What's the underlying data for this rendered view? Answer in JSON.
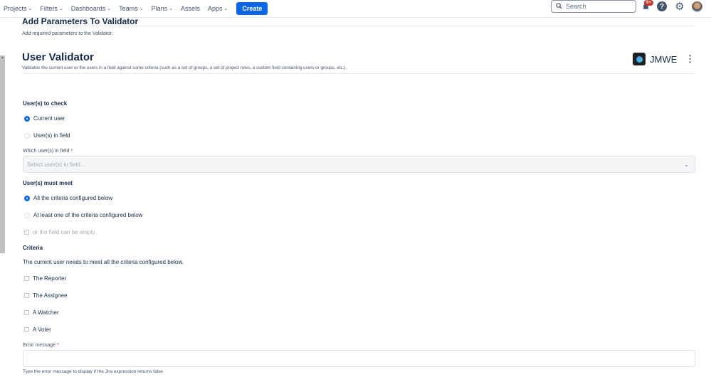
{
  "nav": {
    "items": [
      "Projects",
      "Filters",
      "Dashboards",
      "Teams",
      "Plans",
      "Assets",
      "Apps"
    ],
    "create": "Create",
    "search_placeholder": "Search",
    "notif_badge": "9+"
  },
  "header": {
    "title": "Add Parameters To Validator",
    "subtitle": "Add required parameters to the Validator."
  },
  "validator": {
    "title": "User Validator",
    "description": "Validates the current user or the users in a field against some criteria (such as a set of groups, a set of project roles, a custom field containing users or groups, etc.).",
    "brand": "JMWE"
  },
  "form": {
    "users_to_check": {
      "label": "User(s) to check",
      "options": [
        "Current user",
        "User(s) in field"
      ],
      "selected": 0
    },
    "which_field": {
      "label": "Which user(s) in field",
      "required": "*",
      "placeholder": "Select user(s) in field..."
    },
    "must_meet": {
      "label": "User(s) must meet",
      "options": [
        "All the criteria configured below",
        "At least one of the criteria configured below"
      ],
      "selected": 0,
      "empty_checkbox": "or the field can be empty"
    },
    "criteria": {
      "label": "Criteria",
      "description": "The current user needs to meet all the criteria configured below.",
      "items": [
        "The Reporter",
        "The Assignee",
        "A Watcher",
        "A Voter"
      ]
    },
    "error_message": {
      "label": "Error message",
      "required": "*",
      "value": "",
      "help": "Type the error message to display if the Jira expression returns false."
    }
  },
  "colors": {
    "accent": "#0c66e4",
    "required": "#c9372c"
  }
}
